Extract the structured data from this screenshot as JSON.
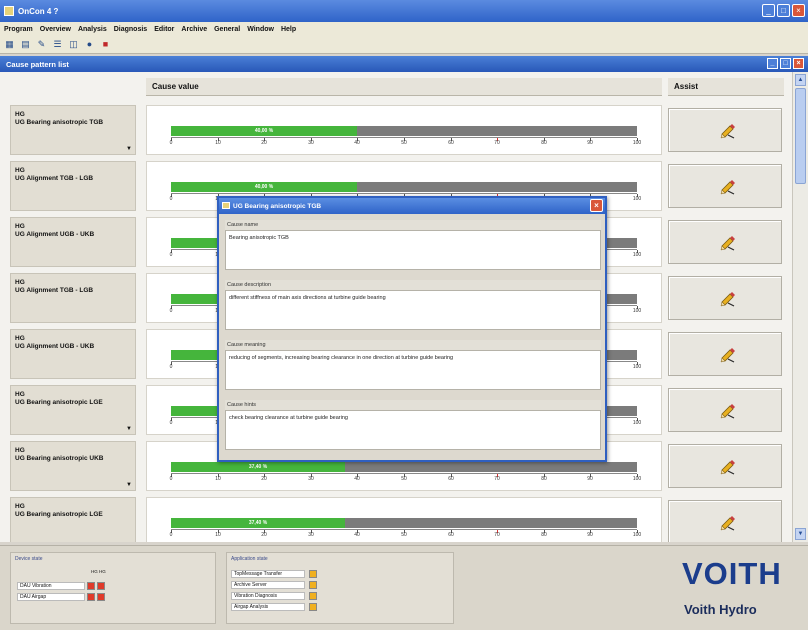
{
  "window": {
    "title": "OnCon 4 ?"
  },
  "menu": [
    "Program",
    "Overview",
    "Analysis",
    "Diagnosis",
    "Editor",
    "Archive",
    "General",
    "Window",
    "Help"
  ],
  "toolbar": {
    "icons": [
      "grid-icon",
      "table-icon",
      "edit-icon",
      "list-icon",
      "chart-icon",
      "globe-icon",
      "exit-icon"
    ]
  },
  "inner_window": {
    "title": "Cause pattern list"
  },
  "columns": {
    "value": "Cause value",
    "assist": "Assist"
  },
  "scale_ticks": [
    "0",
    "10",
    "20",
    "30",
    "40",
    "50",
    "60",
    "70",
    "80",
    "90",
    "100"
  ],
  "rows": [
    {
      "line1": "HG",
      "line2": "UG Bearing anisotropic TGB",
      "value": 40,
      "label": "40,00 %",
      "has_arrow": true
    },
    {
      "line1": "HG",
      "line2": "UG Alignment TGB - LGB",
      "value": 40,
      "label": "40,00 %",
      "has_arrow": false
    },
    {
      "line1": "HG",
      "line2": "UG Alignment UGB - UKB",
      "value": 40,
      "label": "40,00 %",
      "has_arrow": false
    },
    {
      "line1": "HG",
      "line2": "UG Alignment TGB - LGB",
      "value": 40,
      "label": "40,00 %",
      "has_arrow": false
    },
    {
      "line1": "HG",
      "line2": "UG Alignment UGB - UKB",
      "value": 40,
      "label": "40,00 %",
      "has_arrow": false
    },
    {
      "line1": "HG",
      "line2": "UG Bearing anisotropic LGE",
      "value": 40,
      "label": "40,00 %",
      "has_arrow": true
    },
    {
      "line1": "HG",
      "line2": "UG Bearing anisotropic UKB",
      "value": 37.4,
      "label": "37,40 %",
      "has_arrow": true
    },
    {
      "line1": "HG",
      "line2": "UG Bearing anisotropic LGE",
      "value": 37.4,
      "label": "37,40 %",
      "has_arrow": false
    }
  ],
  "dialog": {
    "title": "UG Bearing anisotropic TGB",
    "sections": [
      {
        "label": "Cause name",
        "text": "Bearing anisotropic TGB"
      },
      {
        "label": "Cause description",
        "text": "different stiffness of main axis directions at turbine guide bearing"
      },
      {
        "label": "Cause meaning",
        "text": "reducing of segments, increasing bearing clearance in one direction at turbine guide bearing"
      },
      {
        "label": "Cause hints",
        "text": "check bearing clearance at turbine guide bearing"
      }
    ]
  },
  "device_state": {
    "title": "Device state",
    "headers": "HG  HG",
    "rows": [
      {
        "label": "DAU Vibration"
      },
      {
        "label": "DAU Airgap"
      }
    ]
  },
  "app_state": {
    "title": "Application state",
    "rows": [
      {
        "label": "TopMessage Transfer"
      },
      {
        "label": "Archive Server"
      },
      {
        "label": "Vibration Diagnosis"
      },
      {
        "label": "Airgap Analysis"
      }
    ]
  },
  "brand": {
    "logo": "VOITH",
    "subtitle": "Voith Hydro"
  },
  "colors": {
    "bar_fill": "#45b53c",
    "bar_track": "#7b7b7b",
    "logo": "#1b3d8c"
  }
}
